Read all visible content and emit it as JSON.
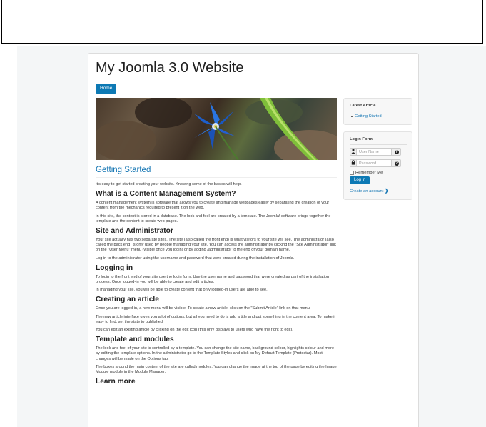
{
  "site": {
    "title": "My Joomla 3.0 Website",
    "nav": {
      "home_label": "Home"
    }
  },
  "article": {
    "title": "Getting Started",
    "sections": [
      {
        "type": "p",
        "text": "It's easy to get started creating your website. Knowing some of the basics will help."
      },
      {
        "type": "h2",
        "text": "What is a Content Management System?"
      },
      {
        "type": "p",
        "text": "A content management system is software that allows you to create and manage webpages easily by separating the creation of your content from the mechanics required to present it on the web."
      },
      {
        "type": "p",
        "text": "In this site, the content is stored in a database. The look and feel are created by a template. The Joomla! software brings together the template and the content to create web pages."
      },
      {
        "type": "h2",
        "text": "Site and Administrator"
      },
      {
        "type": "p",
        "text": "Your site actually has two separate sites. The site (also called the front end) is what visitors to your site will see. The administrator (also called the back end) is only used by people managing your site. You can access the administrator by clicking the \"Site Administrator\" link on the \"User Menu\" menu (visible once you login) or by adding /administrator to the end of your domain name."
      },
      {
        "type": "p",
        "text": "Log in to the administrator using the username and password that were created during the installation of Joomla."
      },
      {
        "type": "h2",
        "text": "Logging in"
      },
      {
        "type": "p",
        "text": "To login to the front end of your site use the login form. Use the user name and password that were created as part of the installation process. Once logged-in you will be able to create and edit articles."
      },
      {
        "type": "p",
        "text": "In managing your site, you will be able to create content that only logged-in users are able to see."
      },
      {
        "type": "h2",
        "text": "Creating an article"
      },
      {
        "type": "p",
        "text": "Once you are logged-in, a new menu will be visible. To create a new article, click on the \"Submit Article\" link on that menu."
      },
      {
        "type": "p",
        "text": "The new article interface gives you a lot of options, but all you need to do is add a title and put something in the content area. To make it easy to find, set the state to published."
      },
      {
        "type": "p",
        "text": "You can edit an existing article by clicking on the edit icon (this only displays to users who have the right to edit)."
      },
      {
        "type": "h2",
        "text": "Template and modules"
      },
      {
        "type": "p",
        "text": "The look and feel of your site is controlled by a template. You can change the site name, background colour, highlights colour and more by editing the template options. In the administrator go to the Template Styles and click on My Default Template (Protostar). Most changes will be made on the Options tab."
      },
      {
        "type": "p",
        "text": "The boxes around the main content of the site are called modules. You can change the image at the top of the page by editing the Image Module module in the Module Manager."
      },
      {
        "type": "h2",
        "text": "Learn more"
      }
    ]
  },
  "sidebar": {
    "latest": {
      "title": "Latest Article",
      "items": [
        "Getting Started"
      ]
    },
    "login": {
      "title": "Login Form",
      "username_placeholder": "User Name",
      "password_placeholder": "Password",
      "remember_label": "Remember Me",
      "login_label": "Log in",
      "create_account_label": "Create an account",
      "create_account_arrow": "❯"
    }
  },
  "colors": {
    "accent": "#0d79b4",
    "link": "#1375b3"
  },
  "icons": {
    "user": "user-icon",
    "lock": "lock-icon",
    "help": "question-icon"
  }
}
